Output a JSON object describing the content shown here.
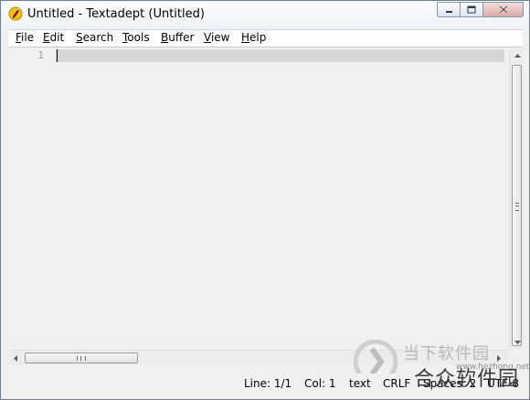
{
  "window": {
    "title": "Untitled - Textadept (Untitled)",
    "app_icon": "textadept-pen-icon",
    "controls": [
      "minimize-icon",
      "maximize-icon",
      "close-icon"
    ]
  },
  "menu": [
    {
      "label": "File",
      "mnemonic": "F",
      "rest": "ile"
    },
    {
      "label": "Edit",
      "mnemonic": "E",
      "rest": "dit"
    },
    {
      "label": "Search",
      "mnemonic": "S",
      "rest": "earch"
    },
    {
      "label": "Tools",
      "mnemonic": "T",
      "rest": "ools"
    },
    {
      "label": "Buffer",
      "mnemonic": "B",
      "rest": "uffer"
    },
    {
      "label": "View",
      "mnemonic": "V",
      "rest": "iew"
    },
    {
      "label": "Help",
      "mnemonic": "H",
      "rest": "elp"
    }
  ],
  "editor": {
    "line_numbers": [
      "1"
    ],
    "content": ""
  },
  "scrollbar": {
    "h_grip": "III"
  },
  "status": {
    "line": "Line: 1/1",
    "col": "Col: 1",
    "lexer": "text",
    "eol": "CRLF",
    "indent": "Spaces: 2",
    "encoding": "UTF-8"
  },
  "watermark": {
    "text1": "当下软件园",
    "text2": "合众软件园",
    "url": "www.hezhong.net"
  },
  "colors": {
    "current_line": "#d7d7d7",
    "background": "#f0f0f0",
    "close_button": "#d9aca4"
  }
}
